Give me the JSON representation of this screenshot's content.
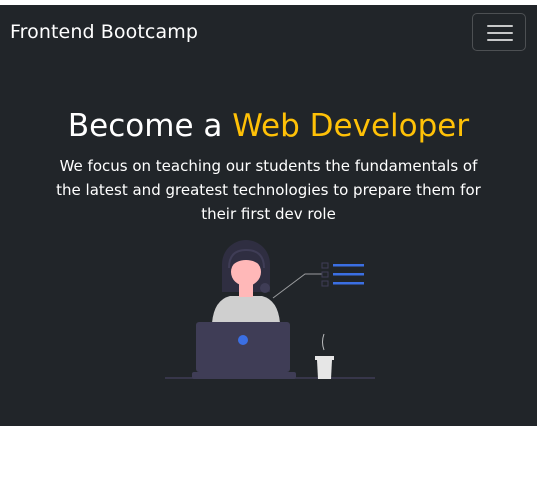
{
  "navbar": {
    "brand": "Frontend Bootcamp",
    "toggler_icon": "hamburger-menu-icon"
  },
  "hero": {
    "title_prefix": "Become a ",
    "title_accent": "Web Developer",
    "lead": "We focus on teaching our students the fundamentals of the latest and greatest technologies to prepare them for their first dev role",
    "illustration": "developer-at-laptop-illustration"
  },
  "colors": {
    "background": "#212529",
    "accent": "#ffc107",
    "illustration_accent": "#3b6fe3"
  }
}
